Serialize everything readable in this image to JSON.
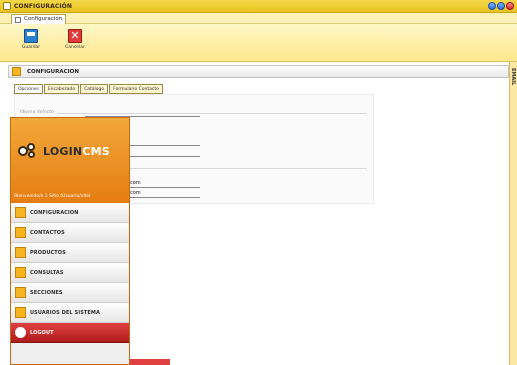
{
  "window": {
    "title": "CONFIGURACIÓN"
  },
  "tab": {
    "label": "Configuración"
  },
  "toolbar": {
    "save_label": "Guardar",
    "cancel_label": "Cancelar"
  },
  "section": {
    "title": "CONFIGURACION",
    "side_label": "EMAIL"
  },
  "form_tabs": [
    "Opciones",
    "Encabezado",
    "Catálogo",
    "Formulario Contacto"
  ],
  "fieldset": {
    "label": "Idioma defecto"
  },
  "emails": [
    "com",
    "com"
  ],
  "brand": {
    "logo_text_a": "LOGIN",
    "logo_text_b": "CMS",
    "welcome": "Bienvenido/a 1 Sitio (Usuario/olla)"
  },
  "menu": [
    {
      "label": "CONFIGURACION",
      "icon": "gear-icon"
    },
    {
      "label": "CONTACTOS",
      "icon": "contacts-icon"
    },
    {
      "label": "PRODUCTOS",
      "icon": "products-icon"
    },
    {
      "label": "CONSULTAS",
      "icon": "inquiries-icon"
    },
    {
      "label": "SECCIONES",
      "icon": "sections-icon"
    },
    {
      "label": "USUARIOS DEL SISTEMA",
      "icon": "users-icon"
    },
    {
      "label": "LOGOUT",
      "icon": "logout-icon"
    }
  ],
  "colors": {
    "accent": "#f6b51e",
    "toolbar": "#fde88c",
    "logout": "#c82626"
  }
}
